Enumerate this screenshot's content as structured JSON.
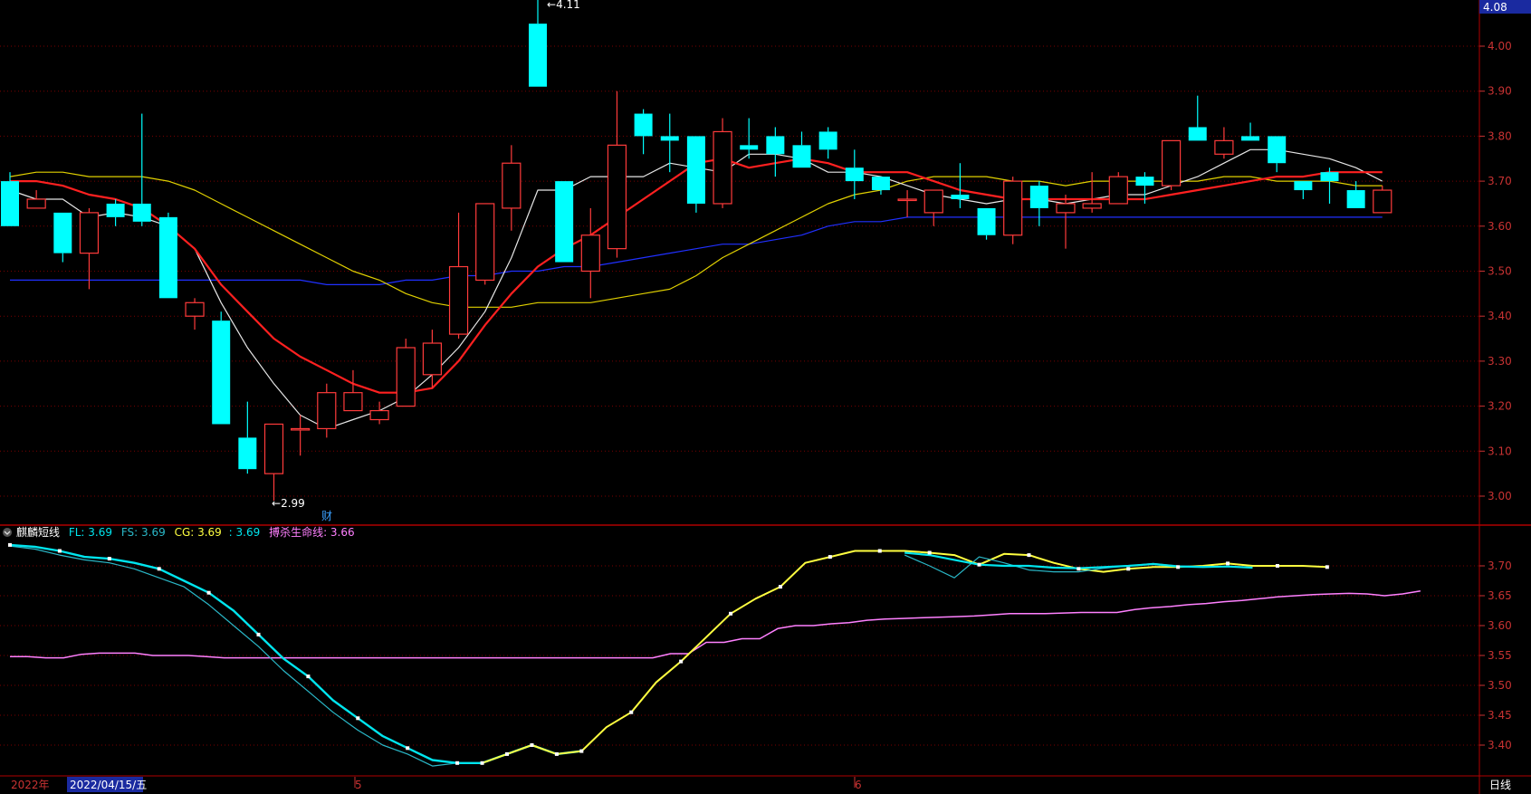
{
  "colors": {
    "up": "#ff3b3b",
    "down": "#00ffff",
    "ma5": "#e6e6e6",
    "ma10": "#ff2020",
    "ma20": "#e0d000",
    "ma60": "#2030ff",
    "fl": "#00e5ee",
    "fs": "#2ab8c8",
    "cg": "#ffff40",
    "life": "#ff80ff",
    "grid": "#7a0000",
    "axis_text": "#c83232"
  },
  "price_axis": {
    "ticks": [
      "4.00",
      "3.90",
      "3.80",
      "3.70",
      "3.60",
      "3.50",
      "3.40",
      "3.30",
      "3.20",
      "3.10",
      "3.00"
    ],
    "current_tag": "4.08"
  },
  "ind_axis": {
    "ticks": [
      "3.70",
      "3.65",
      "3.60",
      "3.55",
      "3.50",
      "3.45",
      "3.40"
    ]
  },
  "annotations": {
    "high": "4.11",
    "low": "2.99",
    "finance_mark": "财"
  },
  "indicator_header": {
    "title": "麒麟短线",
    "fl_label": "FL: 3.69",
    "fs_label": "FS: 3.69",
    "cg_label": "CG: 3.69",
    "cg2_label": ": 3.69",
    "life_label": "搏杀生命线: 3.66"
  },
  "bottom_bar": {
    "year": "2022年",
    "date": "2022/04/15/五",
    "month5": "5",
    "month6": "6",
    "period": "日线"
  },
  "chart_data": {
    "type": "candlestick",
    "candles": [
      [
        3.7,
        3.6,
        3.72,
        3.6
      ],
      [
        3.64,
        3.66,
        3.68,
        3.64
      ],
      [
        3.63,
        3.54,
        3.63,
        3.52
      ],
      [
        3.54,
        3.63,
        3.64,
        3.46
      ],
      [
        3.65,
        3.62,
        3.66,
        3.6
      ],
      [
        3.65,
        3.61,
        3.85,
        3.6
      ],
      [
        3.62,
        3.44,
        3.63,
        3.44
      ],
      [
        3.4,
        3.43,
        3.44,
        3.37
      ],
      [
        3.39,
        3.16,
        3.41,
        3.16
      ],
      [
        3.13,
        3.06,
        3.21,
        3.05
      ],
      [
        3.05,
        3.16,
        3.16,
        2.99
      ],
      [
        3.15,
        3.15,
        3.18,
        3.09
      ],
      [
        3.15,
        3.23,
        3.25,
        3.13
      ],
      [
        3.19,
        3.23,
        3.28,
        3.19
      ],
      [
        3.17,
        3.19,
        3.21,
        3.16
      ],
      [
        3.2,
        3.33,
        3.35,
        3.2
      ],
      [
        3.27,
        3.34,
        3.37,
        3.24
      ],
      [
        3.36,
        3.51,
        3.63,
        3.35
      ],
      [
        3.48,
        3.65,
        3.65,
        3.47
      ],
      [
        3.64,
        3.74,
        3.78,
        3.59
      ],
      [
        4.05,
        3.91,
        4.11,
        3.91
      ],
      [
        3.7,
        3.52,
        3.7,
        3.52
      ],
      [
        3.5,
        3.58,
        3.64,
        3.44
      ],
      [
        3.55,
        3.78,
        3.9,
        3.53
      ],
      [
        3.85,
        3.8,
        3.86,
        3.76
      ],
      [
        3.8,
        3.79,
        3.85,
        3.72
      ],
      [
        3.8,
        3.65,
        3.8,
        3.63
      ],
      [
        3.65,
        3.81,
        3.84,
        3.64
      ],
      [
        3.78,
        3.77,
        3.84,
        3.75
      ],
      [
        3.8,
        3.76,
        3.82,
        3.71
      ],
      [
        3.78,
        3.73,
        3.81,
        3.73
      ],
      [
        3.81,
        3.77,
        3.82,
        3.75
      ],
      [
        3.73,
        3.7,
        3.77,
        3.66
      ],
      [
        3.71,
        3.68,
        3.71,
        3.67
      ],
      [
        3.66,
        3.66,
        3.68,
        3.62
      ],
      [
        3.63,
        3.68,
        3.68,
        3.6
      ],
      [
        3.67,
        3.66,
        3.74,
        3.64
      ],
      [
        3.64,
        3.58,
        3.64,
        3.57
      ],
      [
        3.58,
        3.7,
        3.71,
        3.56
      ],
      [
        3.69,
        3.64,
        3.7,
        3.6
      ],
      [
        3.63,
        3.65,
        3.67,
        3.55
      ],
      [
        3.64,
        3.65,
        3.72,
        3.63
      ],
      [
        3.65,
        3.71,
        3.72,
        3.65
      ],
      [
        3.71,
        3.69,
        3.72,
        3.65
      ],
      [
        3.69,
        3.79,
        3.79,
        3.68
      ],
      [
        3.82,
        3.79,
        3.89,
        3.79
      ],
      [
        3.76,
        3.79,
        3.82,
        3.75
      ],
      [
        3.8,
        3.79,
        3.83,
        3.79
      ],
      [
        3.8,
        3.74,
        3.8,
        3.72
      ],
      [
        3.7,
        3.68,
        3.7,
        3.66
      ],
      [
        3.72,
        3.7,
        3.73,
        3.65
      ],
      [
        3.68,
        3.64,
        3.7,
        3.64
      ],
      [
        3.63,
        3.68,
        3.69,
        3.63
      ]
    ],
    "ma5": [
      3.68,
      3.66,
      3.66,
      3.62,
      3.63,
      3.62,
      3.6,
      3.55,
      3.43,
      3.33,
      3.25,
      3.18,
      3.15,
      3.17,
      3.19,
      3.22,
      3.27,
      3.33,
      3.41,
      3.53,
      3.68,
      3.68,
      3.71,
      3.71,
      3.71,
      3.74,
      3.73,
      3.72,
      3.76,
      3.76,
      3.75,
      3.72,
      3.72,
      3.71,
      3.69,
      3.67,
      3.66,
      3.65,
      3.66,
      3.66,
      3.65,
      3.66,
      3.67,
      3.67,
      3.69,
      3.71,
      3.74,
      3.77,
      3.77,
      3.76,
      3.75,
      3.73,
      3.7
    ],
    "ma10": [
      3.7,
      3.7,
      3.69,
      3.67,
      3.66,
      3.64,
      3.6,
      3.55,
      3.47,
      3.41,
      3.35,
      3.31,
      3.28,
      3.25,
      3.23,
      3.23,
      3.24,
      3.3,
      3.38,
      3.45,
      3.51,
      3.55,
      3.58,
      3.62,
      3.66,
      3.7,
      3.74,
      3.75,
      3.73,
      3.74,
      3.75,
      3.74,
      3.72,
      3.72,
      3.72,
      3.7,
      3.68,
      3.67,
      3.66,
      3.66,
      3.66,
      3.66,
      3.66,
      3.66,
      3.67,
      3.68,
      3.69,
      3.7,
      3.71,
      3.71,
      3.72,
      3.72,
      3.72
    ],
    "ma20": [
      3.71,
      3.72,
      3.72,
      3.71,
      3.71,
      3.71,
      3.7,
      3.68,
      3.65,
      3.62,
      3.59,
      3.56,
      3.53,
      3.5,
      3.48,
      3.45,
      3.43,
      3.42,
      3.42,
      3.42,
      3.43,
      3.43,
      3.43,
      3.44,
      3.45,
      3.46,
      3.49,
      3.53,
      3.56,
      3.59,
      3.62,
      3.65,
      3.67,
      3.68,
      3.7,
      3.71,
      3.71,
      3.71,
      3.7,
      3.7,
      3.69,
      3.7,
      3.7,
      3.7,
      3.7,
      3.7,
      3.71,
      3.71,
      3.7,
      3.7,
      3.7,
      3.69,
      3.69
    ],
    "ma60": [
      3.48,
      3.48,
      3.48,
      3.48,
      3.48,
      3.48,
      3.48,
      3.48,
      3.48,
      3.48,
      3.48,
      3.48,
      3.47,
      3.47,
      3.47,
      3.48,
      3.48,
      3.49,
      3.49,
      3.5,
      3.5,
      3.51,
      3.51,
      3.52,
      3.53,
      3.54,
      3.55,
      3.56,
      3.56,
      3.57,
      3.58,
      3.6,
      3.61,
      3.61,
      3.62,
      3.62,
      3.62,
      3.62,
      3.62,
      3.62,
      3.62,
      3.62,
      3.62,
      3.62,
      3.62,
      3.62,
      3.62,
      3.62,
      3.62,
      3.62,
      3.62,
      3.62,
      3.62
    ],
    "fl": [
      3.735,
      3.732,
      3.725,
      3.715,
      3.712,
      3.705,
      3.695,
      3.675,
      3.655,
      3.625,
      3.585,
      3.545,
      3.515,
      3.475,
      3.445,
      3.415,
      3.395,
      3.375,
      3.37,
      3.37,
      3.385,
      3.4,
      3.385,
      3.39
    ],
    "fs": [
      3.733,
      3.728,
      3.718,
      3.71,
      3.705,
      3.695,
      3.68,
      3.665,
      3.635,
      3.6,
      3.565,
      3.525,
      3.49,
      3.455,
      3.425,
      3.4,
      3.385,
      3.365,
      3.37,
      3.37,
      3.385,
      3.4,
      3.385,
      3.39
    ],
    "cg": [
      3.37,
      3.385,
      3.4,
      3.385,
      3.39,
      3.43,
      3.455,
      3.505,
      3.54,
      3.58,
      3.62,
      3.645,
      3.665,
      3.705,
      3.715,
      3.725,
      3.725,
      3.725,
      3.722,
      3.718,
      3.702,
      3.72,
      3.718,
      3.705,
      3.695,
      3.69,
      3.695,
      3.698,
      3.698,
      3.7,
      3.704,
      3.7,
      3.7,
      3.7,
      3.698
    ],
    "fl2": [
      3.722,
      3.718,
      3.71,
      3.702,
      3.7,
      3.7,
      3.697,
      3.696,
      3.698,
      3.7,
      3.703,
      3.699,
      3.698,
      3.699,
      3.697
    ],
    "fs2": [
      3.718,
      3.7,
      3.68,
      3.715,
      3.705,
      3.693,
      3.69,
      3.69,
      3.696,
      3.7,
      3.704,
      3.7,
      3.699,
      3.699,
      3.697
    ],
    "life": [
      3.548,
      3.548,
      3.546,
      3.546,
      3.552,
      3.554,
      3.554,
      3.554,
      3.55,
      3.55,
      3.55,
      3.548,
      3.546,
      3.546,
      3.546,
      3.546,
      3.546,
      3.546,
      3.546,
      3.546,
      3.546,
      3.546,
      3.546,
      3.546,
      3.546,
      3.546,
      3.546,
      3.546,
      3.546,
      3.546,
      3.546,
      3.546,
      3.546,
      3.546,
      3.546,
      3.546,
      3.546,
      3.553,
      3.553,
      3.572,
      3.572,
      3.578,
      3.578,
      3.595,
      3.6,
      3.6,
      3.603,
      3.605,
      3.609,
      3.611,
      3.612,
      3.613,
      3.614,
      3.615,
      3.616,
      3.618,
      3.62,
      3.62,
      3.62,
      3.621,
      3.622,
      3.622,
      3.622,
      3.627,
      3.63,
      3.632,
      3.635,
      3.637,
      3.64,
      3.642,
      3.645,
      3.648,
      3.65,
      3.652,
      3.653,
      3.654,
      3.653,
      3.65,
      3.653,
      3.658
    ]
  }
}
